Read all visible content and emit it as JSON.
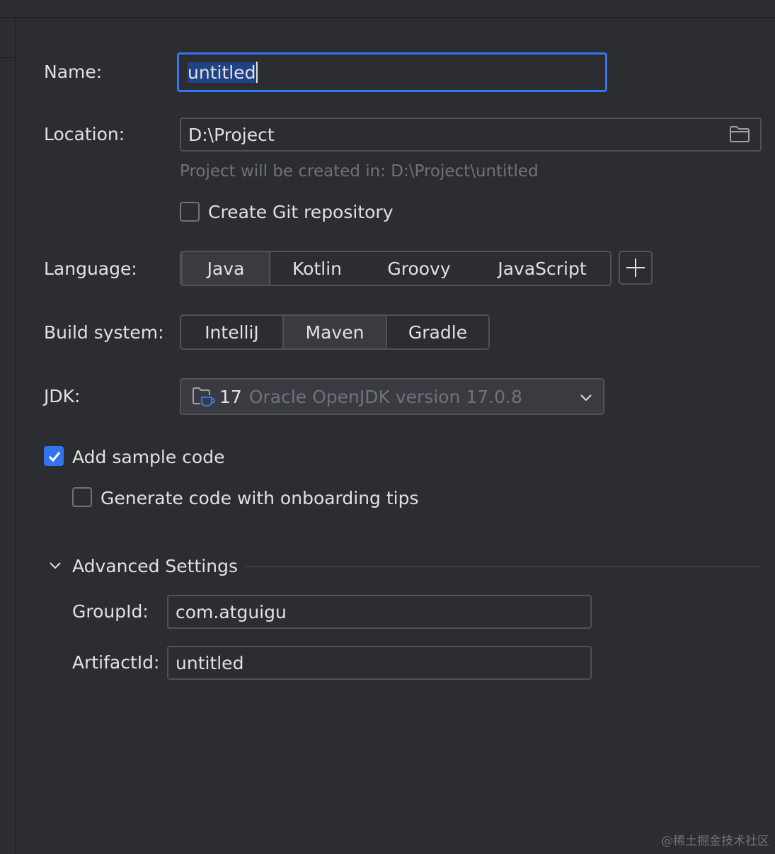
{
  "form": {
    "name_label": "Name:",
    "name_value": "untitled",
    "location_label": "Location:",
    "location_value": "D:\\Project",
    "location_hint": "Project will be created in: D:\\Project\\untitled",
    "git_label": "Create Git repository",
    "git_checked": false,
    "language_label": "Language:",
    "languages": [
      "Java",
      "Kotlin",
      "Groovy",
      "JavaScript"
    ],
    "language_selected": "Java",
    "build_label": "Build system:",
    "build_systems": [
      "IntelliJ",
      "Maven",
      "Gradle"
    ],
    "build_selected": "Maven",
    "jdk_label": "JDK:",
    "jdk_version": "17",
    "jdk_desc": "Oracle OpenJDK version 17.0.8",
    "sample_code_label": "Add sample code",
    "sample_code_checked": true,
    "onboarding_label": "Generate code with onboarding tips",
    "onboarding_checked": false
  },
  "advanced": {
    "title": "Advanced Settings",
    "expanded": true,
    "group_label": "GroupId:",
    "group_value": "com.atguigu",
    "artifact_label": "ArtifactId:",
    "artifact_value": "untitled"
  },
  "colors": {
    "background": "#2b2d30",
    "accent": "#3574f0",
    "border": "#4e5157",
    "muted_text": "#6f737a"
  },
  "watermark": "@稀土掘金技术社区"
}
